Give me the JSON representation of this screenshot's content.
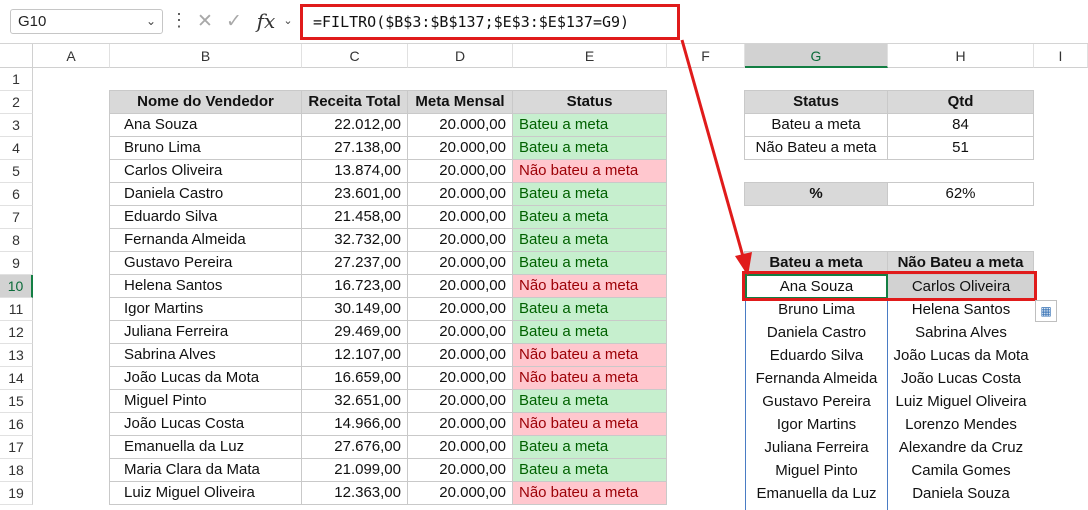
{
  "formula_bar": {
    "name_box": "G10",
    "fx_label": "fx",
    "formula": "=FILTRO($B$3:$B$137;$E$3:$E$137=G9)",
    "cancel_glyph": "✕",
    "enter_glyph": "✓"
  },
  "columns": [
    "A",
    "B",
    "C",
    "D",
    "E",
    "F",
    "G",
    "H",
    "I"
  ],
  "rows": [
    "1",
    "2",
    "3",
    "4",
    "5",
    "6",
    "7",
    "8",
    "9",
    "10",
    "11",
    "12",
    "13",
    "14",
    "15",
    "16",
    "17",
    "18",
    "19"
  ],
  "main_table": {
    "headers": [
      "Nome do Vendedor",
      "Receita Total",
      "Meta Mensal",
      "Status"
    ],
    "rows": [
      {
        "name": "Ana Souza",
        "receita": "22.012,00",
        "meta": "20.000,00",
        "status": "Bateu a meta",
        "ok": true
      },
      {
        "name": "Bruno Lima",
        "receita": "27.138,00",
        "meta": "20.000,00",
        "status": "Bateu a meta",
        "ok": true
      },
      {
        "name": "Carlos Oliveira",
        "receita": "13.874,00",
        "meta": "20.000,00",
        "status": "Não bateu a meta",
        "ok": false
      },
      {
        "name": "Daniela Castro",
        "receita": "23.601,00",
        "meta": "20.000,00",
        "status": "Bateu a meta",
        "ok": true
      },
      {
        "name": "Eduardo Silva",
        "receita": "21.458,00",
        "meta": "20.000,00",
        "status": "Bateu a meta",
        "ok": true
      },
      {
        "name": "Fernanda Almeida",
        "receita": "32.732,00",
        "meta": "20.000,00",
        "status": "Bateu a meta",
        "ok": true
      },
      {
        "name": "Gustavo Pereira",
        "receita": "27.237,00",
        "meta": "20.000,00",
        "status": "Bateu a meta",
        "ok": true
      },
      {
        "name": "Helena Santos",
        "receita": "16.723,00",
        "meta": "20.000,00",
        "status": "Não bateu a meta",
        "ok": false
      },
      {
        "name": "Igor Martins",
        "receita": "30.149,00",
        "meta": "20.000,00",
        "status": "Bateu a meta",
        "ok": true
      },
      {
        "name": "Juliana Ferreira",
        "receita": "29.469,00",
        "meta": "20.000,00",
        "status": "Bateu a meta",
        "ok": true
      },
      {
        "name": "Sabrina Alves",
        "receita": "12.107,00",
        "meta": "20.000,00",
        "status": "Não bateu a meta",
        "ok": false
      },
      {
        "name": "João Lucas da Mota",
        "receita": "16.659,00",
        "meta": "20.000,00",
        "status": "Não bateu a meta",
        "ok": false
      },
      {
        "name": "Miguel Pinto",
        "receita": "32.651,00",
        "meta": "20.000,00",
        "status": "Bateu a meta",
        "ok": true
      },
      {
        "name": "João Lucas Costa",
        "receita": "14.966,00",
        "meta": "20.000,00",
        "status": "Não bateu a meta",
        "ok": false
      },
      {
        "name": "Emanuella da Luz",
        "receita": "27.676,00",
        "meta": "20.000,00",
        "status": "Bateu a meta",
        "ok": true
      },
      {
        "name": "Maria Clara da Mata",
        "receita": "21.099,00",
        "meta": "20.000,00",
        "status": "Bateu a meta",
        "ok": true
      },
      {
        "name": "Luiz Miguel Oliveira",
        "receita": "12.363,00",
        "meta": "20.000,00",
        "status": "Não bateu a meta",
        "ok": false
      }
    ]
  },
  "summary_table": {
    "headers": [
      "Status",
      "Qtd"
    ],
    "rows": [
      [
        "Bateu a meta",
        "84"
      ],
      [
        "Não Bateu a meta",
        "51"
      ]
    ]
  },
  "percent": {
    "label": "%",
    "value": "62%"
  },
  "filter_table": {
    "headers": [
      "Bateu a meta",
      "Não Bateu a meta"
    ],
    "bateu": [
      "Ana Souza",
      "Bruno Lima",
      "Daniela Castro",
      "Eduardo Silva",
      "Fernanda Almeida",
      "Gustavo Pereira",
      "Igor Martins",
      "Juliana Ferreira",
      "Miguel Pinto",
      "Emanuella da Luz"
    ],
    "nao_bateu": [
      "Carlos Oliveira",
      "Helena Santos",
      "Sabrina Alves",
      "João Lucas da Mota",
      "João Lucas Costa",
      "Luiz Miguel Oliveira",
      "Lorenzo Mendes",
      "Alexandre da Cruz",
      "Camila Gomes",
      "Daniela Souza"
    ]
  },
  "colors": {
    "accent_red": "#e01b1b",
    "ok_fill": "#c6efce",
    "no_fill": "#ffc7ce",
    "selection_green": "#137e43"
  }
}
